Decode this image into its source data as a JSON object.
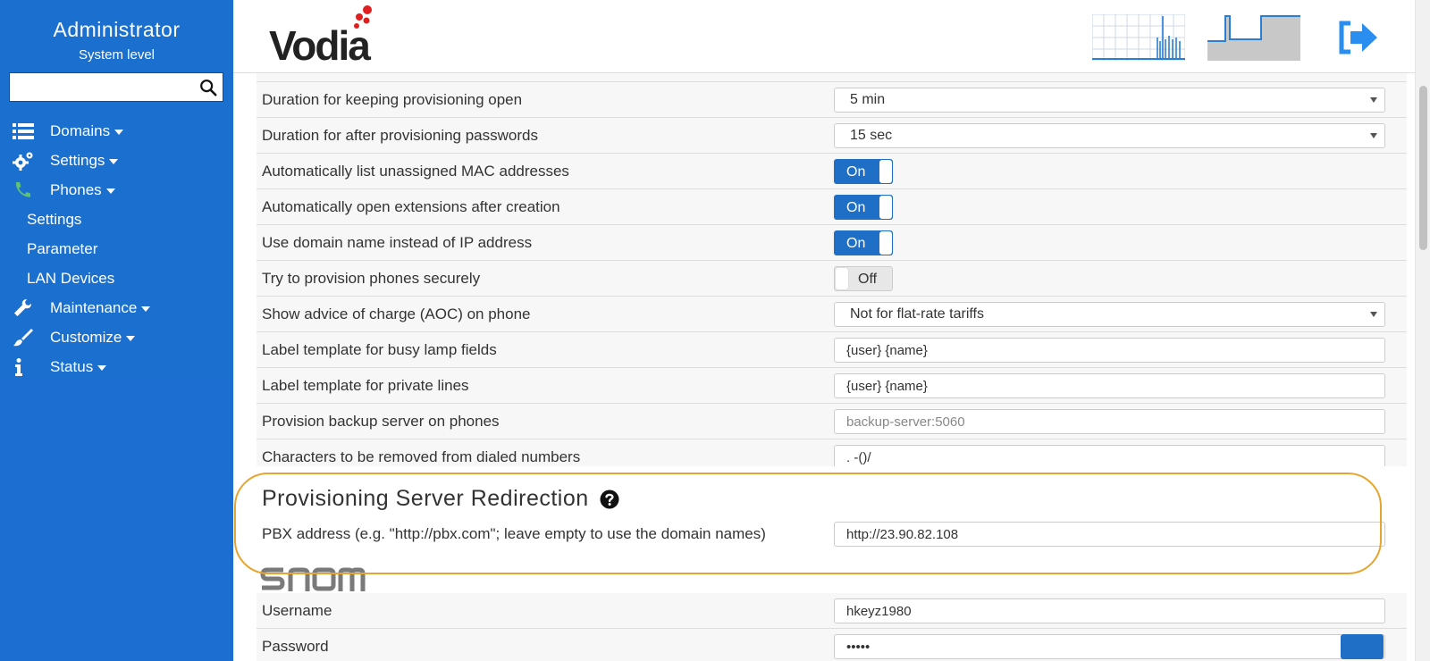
{
  "sidebar": {
    "title": "Administrator",
    "subtitle": "System level",
    "search": {
      "value": "",
      "placeholder": ""
    },
    "nav": [
      {
        "label": "Domains",
        "icon": "list-icon"
      },
      {
        "label": "Settings",
        "icon": "gears-icon"
      },
      {
        "label": "Phones",
        "icon": "phone-icon"
      }
    ],
    "phones_sub": [
      "Settings",
      "Parameter",
      "LAN Devices"
    ],
    "nav2": [
      {
        "label": "Maintenance",
        "icon": "wrench-icon"
      },
      {
        "label": "Customize",
        "icon": "brush-icon"
      },
      {
        "label": "Status",
        "icon": "info-icon"
      }
    ]
  },
  "header": {
    "logo": "Vodia",
    "colors": {
      "accent": "#1a6fcf",
      "logo_dots": "#e02020",
      "highlight": "#e6a52e"
    }
  },
  "settings": [
    {
      "label": "Duration for keeping provisioning open",
      "type": "select",
      "value": "5 min"
    },
    {
      "label": "Duration for after provisioning passwords",
      "type": "select",
      "value": "15 sec"
    },
    {
      "label": "Automatically list unassigned MAC addresses",
      "type": "toggle",
      "value": "On"
    },
    {
      "label": "Automatically open extensions after creation",
      "type": "toggle",
      "value": "On"
    },
    {
      "label": "Use domain name instead of IP address",
      "type": "toggle",
      "value": "On"
    },
    {
      "label": "Try to provision phones securely",
      "type": "toggle",
      "value": "Off"
    },
    {
      "label": "Show advice of charge (AOC) on phone",
      "type": "select",
      "value": "Not for flat-rate tariffs"
    },
    {
      "label": "Label template for busy lamp fields",
      "type": "text",
      "value": "{user} {name}"
    },
    {
      "label": "Label template for private lines",
      "type": "text",
      "value": "{user} {name}"
    },
    {
      "label": "Provision backup server on phones",
      "type": "text",
      "placeholder": "backup-server:5060"
    },
    {
      "label": "Characters to be removed from dialed numbers",
      "type": "text",
      "value": ". -()/"
    }
  ],
  "redirection": {
    "title": "Provisioning Server Redirection",
    "pbx_label": "PBX address (e.g. \"http://pbx.com\"; leave empty to use the domain names)",
    "pbx_value": "http://23.90.82.108"
  },
  "snom": {
    "brand": "snom",
    "username_label": "Username",
    "username_value": "hkeyz1980",
    "password_label": "Password",
    "password_value": "•••••"
  }
}
